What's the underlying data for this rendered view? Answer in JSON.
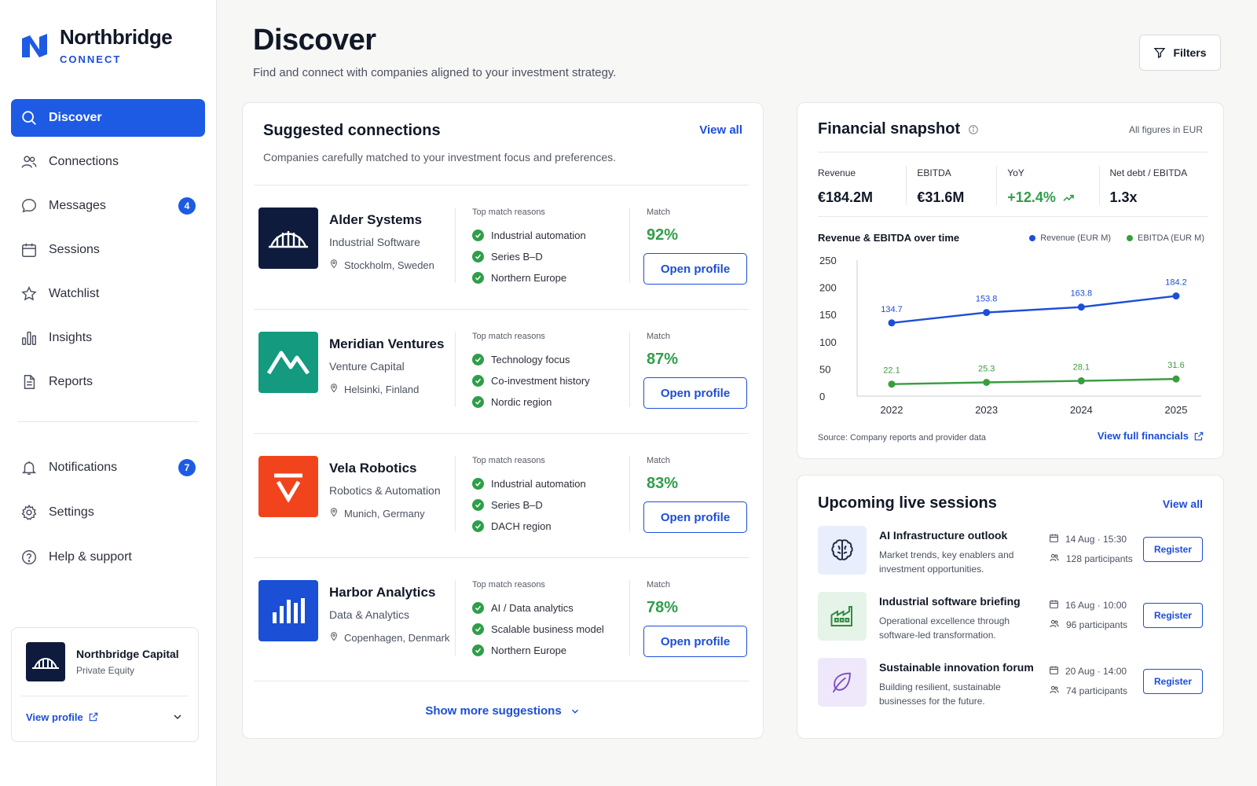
{
  "brand": {
    "name": "Northbridge",
    "sub": "CONNECT"
  },
  "nav": {
    "items": [
      {
        "label": "Discover",
        "icon": "search-icon",
        "active": true
      },
      {
        "label": "Connections",
        "icon": "users-icon"
      },
      {
        "label": "Messages",
        "icon": "message-icon",
        "badge": "4"
      },
      {
        "label": "Sessions",
        "icon": "calendar-icon"
      },
      {
        "label": "Watchlist",
        "icon": "star-icon"
      },
      {
        "label": "Insights",
        "icon": "bar-chart-icon"
      },
      {
        "label": "Reports",
        "icon": "document-icon"
      }
    ],
    "secondary": [
      {
        "label": "Notifications",
        "icon": "bell-icon",
        "badge": "7"
      },
      {
        "label": "Settings",
        "icon": "gear-icon"
      },
      {
        "label": "Help & support",
        "icon": "help-icon"
      }
    ]
  },
  "org": {
    "name": "Northbridge Capital",
    "type": "Private Equity",
    "view_profile": "View profile"
  },
  "header": {
    "title": "Discover",
    "subtitle": "Find and connect with companies aligned to your investment strategy.",
    "filters_label": "Filters"
  },
  "suggested": {
    "title": "Suggested connections",
    "subtitle": "Companies carefully matched to your investment focus and preferences.",
    "view_all": "View all",
    "reasons_label": "Top match reasons",
    "match_label": "Match",
    "open_label": "Open profile",
    "show_more": "Show more suggestions",
    "companies": [
      {
        "name": "Alder Systems",
        "industry": "Industrial Software",
        "location": "Stockholm, Sweden",
        "reasons": [
          "Industrial automation",
          "Series B–D",
          "Northern Europe"
        ],
        "match": "92%",
        "logo_color": "#0f1b3d"
      },
      {
        "name": "Meridian Ventures",
        "industry": "Venture Capital",
        "location": "Helsinki, Finland",
        "reasons": [
          "Technology focus",
          "Co-investment history",
          "Nordic region"
        ],
        "match": "87%",
        "logo_color": "#139a7f"
      },
      {
        "name": "Vela Robotics",
        "industry": "Robotics & Automation",
        "location": "Munich, Germany",
        "reasons": [
          "Industrial automation",
          "Series B–D",
          "DACH region"
        ],
        "match": "83%",
        "logo_color": "#f2441c"
      },
      {
        "name": "Harbor Analytics",
        "industry": "Data & Analytics",
        "location": "Copenhagen, Denmark",
        "reasons": [
          "AI / Data analytics",
          "Scalable business model",
          "Northern Europe"
        ],
        "match": "78%",
        "logo_color": "#1a4fd6"
      }
    ]
  },
  "financial": {
    "title": "Financial snapshot",
    "note": "All figures in EUR",
    "metrics": [
      {
        "label": "Revenue",
        "value": "€184.2M"
      },
      {
        "label": "EBITDA",
        "value": "€31.6M"
      },
      {
        "label": "YoY",
        "value": "+12.4%"
      },
      {
        "label": "Net debt / EBITDA",
        "value": "1.3x"
      }
    ],
    "chart_title": "Revenue & EBITDA over time",
    "source": "Source: Company reports and provider data",
    "view_full": "View full financials"
  },
  "chart_data": {
    "type": "line",
    "title": "Revenue & EBITDA over time",
    "x": [
      "2022",
      "2023",
      "2024",
      "2025"
    ],
    "series": [
      {
        "name": "Revenue (EUR M)",
        "values": [
          134.7,
          153.8,
          163.8,
          184.2
        ],
        "color": "#1d4ed8"
      },
      {
        "name": "EBITDA (EUR M)",
        "values": [
          22.1,
          25.3,
          28.1,
          31.6
        ],
        "color": "#3a9d3f"
      }
    ],
    "ylim": [
      0,
      250
    ],
    "yticks": [
      0,
      50,
      100,
      150,
      200,
      250
    ],
    "grid": false,
    "legend": "top-right"
  },
  "sessions": {
    "title": "Upcoming live sessions",
    "view_all": "View all",
    "register_label": "Register",
    "items": [
      {
        "title": "AI Infrastructure outlook",
        "desc": "Market trends, key enablers and investment opportunities.",
        "date": "14 Aug · 15:30",
        "participants": "128 participants",
        "icon": "brain-icon",
        "bg": "#e8eefc"
      },
      {
        "title": "Industrial software briefing",
        "desc": "Operational excellence through software-led transformation.",
        "date": "16 Aug · 10:00",
        "participants": "96 participants",
        "icon": "factory-icon",
        "bg": "#e5f3e8"
      },
      {
        "title": "Sustainable innovation forum",
        "desc": "Building resilient, sustainable businesses for the future.",
        "date": "20 Aug · 14:00",
        "participants": "74 participants",
        "icon": "leaf-icon",
        "bg": "#efe8fa"
      }
    ]
  }
}
